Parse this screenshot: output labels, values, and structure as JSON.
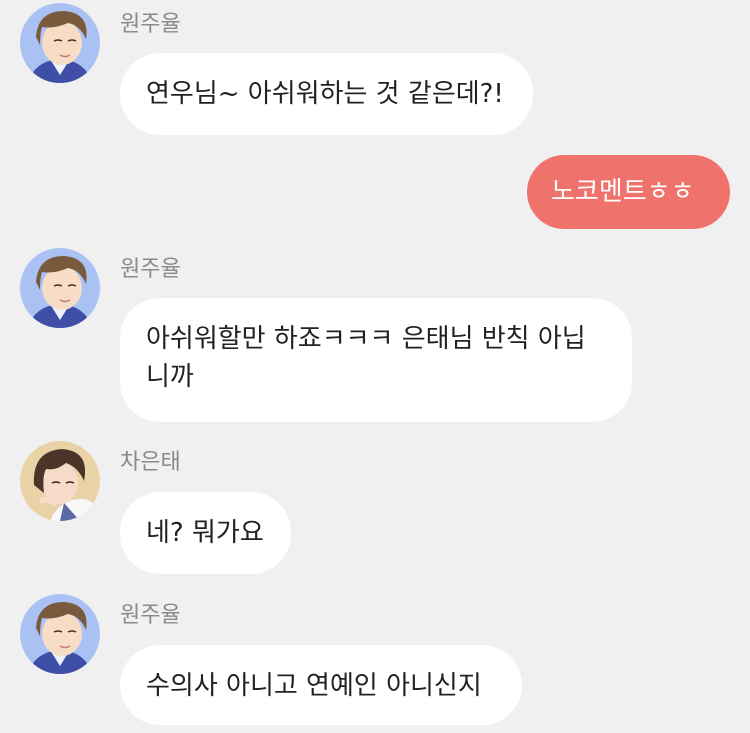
{
  "colors": {
    "background": "#f0f0f0",
    "bubble_received": "#ffffff",
    "bubble_sent": "#ef726d",
    "name_text": "#8a8a8a"
  },
  "messages": [
    {
      "sender": "원주율",
      "avatar": "avatar-wonjuyul",
      "side": "left",
      "lines": [
        "연우님~ 아쉬워하는 것 같은데?!"
      ]
    },
    {
      "sender": "",
      "side": "right",
      "lines": [
        "노코멘트ㅎㅎ"
      ]
    },
    {
      "sender": "원주율",
      "avatar": "avatar-wonjuyul",
      "side": "left",
      "lines": [
        "아쉬워할만 하죠ㅋㅋㅋ 은태님 반칙 아닙",
        "니까"
      ]
    },
    {
      "sender": "차은태",
      "avatar": "avatar-chaeuntae",
      "side": "left",
      "lines": [
        "네? 뭐가요"
      ]
    },
    {
      "sender": "원주율",
      "avatar": "avatar-wonjuyul",
      "side": "left",
      "lines": [
        "수의사 아니고 연예인 아니신지"
      ]
    }
  ]
}
